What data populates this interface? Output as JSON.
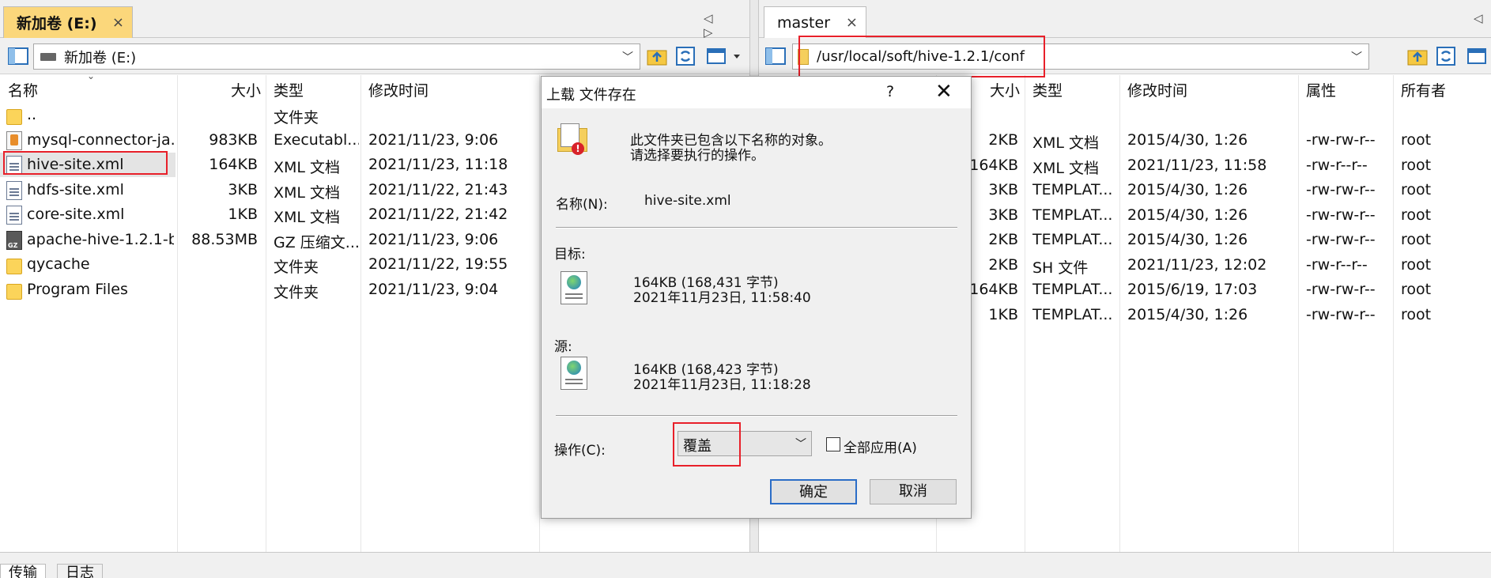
{
  "left": {
    "tab_label": "新加卷 (E:)",
    "tab_close": "×",
    "tab_arrows": "◁ ▷",
    "address": "新加卷 (E:)",
    "columns": [
      "名称",
      "大小",
      "类型",
      "修改时间"
    ],
    "files": [
      {
        "name": "..",
        "size": "",
        "type": "文件夹",
        "modified": "",
        "icon": "folder-icon"
      },
      {
        "name": "mysql-connector-ja...",
        "size": "983KB",
        "type": "Executabl...",
        "modified": "2021/11/23, 9:06",
        "icon": "jar-icon"
      },
      {
        "name": "hive-site.xml",
        "size": "164KB",
        "type": "XML 文档",
        "modified": "2021/11/23, 11:18",
        "icon": "xml-file-icon"
      },
      {
        "name": "hdfs-site.xml",
        "size": "3KB",
        "type": "XML 文档",
        "modified": "2021/11/22, 21:43",
        "icon": "xml-file-icon"
      },
      {
        "name": "core-site.xml",
        "size": "1KB",
        "type": "XML 文档",
        "modified": "2021/11/22, 21:42",
        "icon": "xml-file-icon"
      },
      {
        "name": "apache-hive-1.2.1-b...",
        "size": "88.53MB",
        "type": "GZ 压缩文...",
        "modified": "2021/11/23, 9:06",
        "icon": "gz-archive-icon"
      },
      {
        "name": "qycache",
        "size": "",
        "type": "文件夹",
        "modified": "2021/11/22, 19:55",
        "icon": "folder-icon"
      },
      {
        "name": "Program Files",
        "size": "",
        "type": "文件夹",
        "modified": "2021/11/23, 9:04",
        "icon": "folder-icon"
      }
    ]
  },
  "right": {
    "tab_label": "master",
    "tab_close": "×",
    "tab_arrow": "◁",
    "address": "/usr/local/soft/hive-1.2.1/conf",
    "columns": [
      "大小",
      "类型",
      "修改时间",
      "属性",
      "所有者"
    ],
    "files": [
      {
        "size": "2KB",
        "type": "XML 文档",
        "modified": "2015/4/30, 1:26",
        "attr": "-rw-rw-r--",
        "owner": "root"
      },
      {
        "size": "164KB",
        "type": "XML 文档",
        "modified": "2021/11/23, 11:58",
        "attr": "-rw-r--r--",
        "owner": "root"
      },
      {
        "size": "3KB",
        "type": "TEMPLAT...",
        "modified": "2015/4/30, 1:26",
        "attr": "-rw-rw-r--",
        "owner": "root"
      },
      {
        "size": "3KB",
        "type": "TEMPLAT...",
        "modified": "2015/4/30, 1:26",
        "attr": "-rw-rw-r--",
        "owner": "root"
      },
      {
        "size": "2KB",
        "type": "TEMPLAT...",
        "modified": "2015/4/30, 1:26",
        "attr": "-rw-rw-r--",
        "owner": "root"
      },
      {
        "size": "2KB",
        "type": "SH 文件",
        "modified": "2021/11/23, 12:02",
        "attr": "-rw-r--r--",
        "owner": "root"
      },
      {
        "size": "164KB",
        "type": "TEMPLAT...",
        "modified": "2015/6/19, 17:03",
        "attr": "-rw-rw-r--",
        "owner": "root"
      },
      {
        "size": "1KB",
        "type": "TEMPLAT...",
        "modified": "2015/4/30, 1:26",
        "attr": "-rw-rw-r--",
        "owner": "root"
      }
    ]
  },
  "dialog": {
    "title": "上载 文件存在",
    "help": "?",
    "close": "✕",
    "message_line1": "此文件夹已包含以下名称的对象。",
    "message_line2": "请选择要执行的操作。",
    "name_label": "名称(N):",
    "name_value": "hive-site.xml",
    "target_label": "目标:",
    "target_size": "164KB (168,431 字节)",
    "target_date": "2021年11月23日, 11:58:40",
    "source_label": "源:",
    "source_size": "164KB (168,423 字节)",
    "source_date": "2021年11月23日, 11:18:28",
    "action_label": "操作(C):",
    "action_value": "覆盖",
    "apply_all_label": "全部应用(A)",
    "ok_label": "确定",
    "cancel_label": "取消"
  },
  "bottom_tabs": [
    "传输",
    "日志"
  ]
}
